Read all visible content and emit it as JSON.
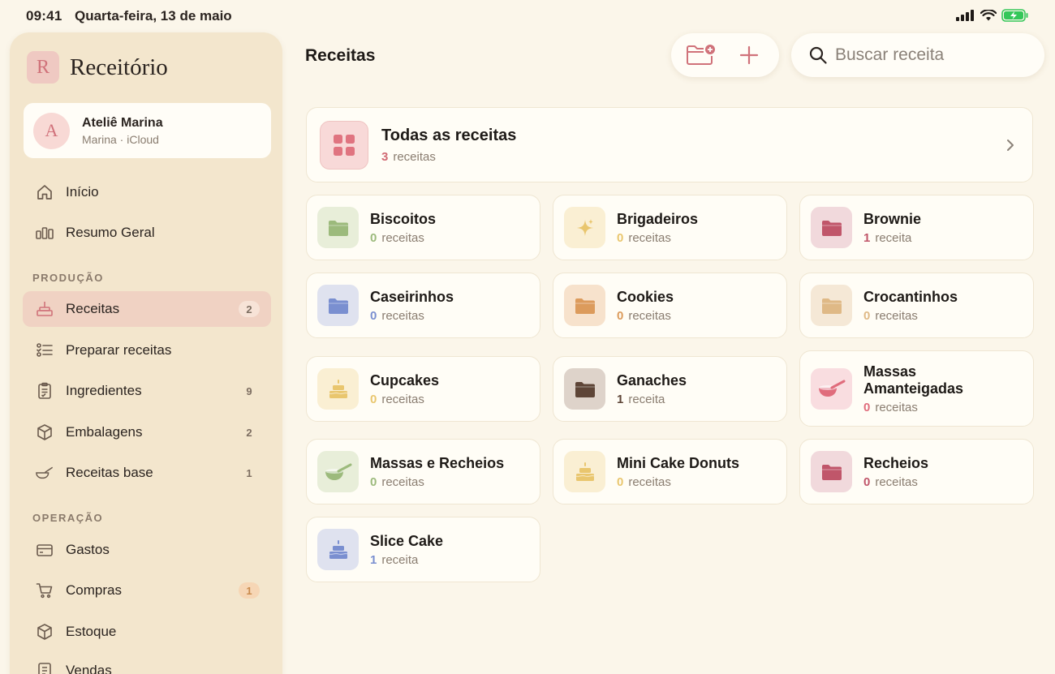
{
  "status": {
    "time": "09:41",
    "date": "Quarta-feira, 13 de maio"
  },
  "sidebar": {
    "brand": {
      "mark": "R",
      "title": "Receitório"
    },
    "account": {
      "initial": "A",
      "name": "Ateliê Marina",
      "subtitle": "Marina · iCloud"
    },
    "items": [
      {
        "label": "Início",
        "icon": "house-icon"
      },
      {
        "label": "Resumo Geral",
        "icon": "bar-chart-icon"
      }
    ],
    "sections": [
      {
        "title": "PRODUÇÃO",
        "items": [
          {
            "label": "Receitas",
            "icon": "cake-icon",
            "badge": "2",
            "active": true
          },
          {
            "label": "Preparar receitas",
            "icon": "checklist-icon",
            "badge": ""
          },
          {
            "label": "Ingredientes",
            "icon": "clipboard-icon",
            "badge": "9"
          },
          {
            "label": "Embalagens",
            "icon": "box-icon",
            "badge": "2"
          },
          {
            "label": "Receitas base",
            "icon": "bowl-icon",
            "badge": "1"
          }
        ]
      },
      {
        "title": "OPERAÇÃO",
        "items": [
          {
            "label": "Gastos",
            "icon": "card-icon",
            "badge": ""
          },
          {
            "label": "Compras",
            "icon": "cart-icon",
            "badge": "1"
          },
          {
            "label": "Estoque",
            "icon": "box-icon",
            "badge": ""
          },
          {
            "label": "Vendas",
            "icon": "receipt-icon",
            "badge": ""
          }
        ]
      }
    ]
  },
  "main": {
    "title": "Receitas",
    "toolbar": {
      "new_folder_icon": "folder-plus-icon",
      "add_icon": "plus-icon"
    },
    "search": {
      "placeholder": "Buscar receita",
      "value": ""
    },
    "all_recipes": {
      "title": "Todas as receitas",
      "count": "3",
      "unit": "receitas"
    },
    "categories": [
      {
        "name": "Biscoitos",
        "count": "0",
        "unit": "receitas",
        "icon": "folder-icon",
        "color": "#9cba7c",
        "bg": "#e8eed9"
      },
      {
        "name": "Brigadeiros",
        "count": "0",
        "unit": "receitas",
        "icon": "sparkle-icon",
        "color": "#e9c66e",
        "bg": "#faefd3"
      },
      {
        "name": "Brownie",
        "count": "1",
        "unit": "receita",
        "icon": "folder-icon",
        "color": "#c0566a",
        "bg": "#f1d9dc"
      },
      {
        "name": "Caseirinhos",
        "count": "0",
        "unit": "receitas",
        "icon": "folder-icon",
        "color": "#7a8fd0",
        "bg": "#dfe2ef"
      },
      {
        "name": "Cookies",
        "count": "0",
        "unit": "receitas",
        "icon": "folder-icon",
        "color": "#dc9b5c",
        "bg": "#f7e2cc"
      },
      {
        "name": "Crocantinhos",
        "count": "0",
        "unit": "receitas",
        "icon": "folder-icon",
        "color": "#dfb986",
        "bg": "#f5e8d6"
      },
      {
        "name": "Cupcakes",
        "count": "0",
        "unit": "receitas",
        "icon": "cake-icon",
        "color": "#e9c66e",
        "bg": "#faefd3"
      },
      {
        "name": "Ganaches",
        "count": "1",
        "unit": "receita",
        "icon": "folder-icon",
        "color": "#5e4537",
        "bg": "#ded3ca"
      },
      {
        "name": "Massas Amanteigadas",
        "count": "0",
        "unit": "receitas",
        "icon": "bowl-icon",
        "color": "#e06c7c",
        "bg": "#f9dde0"
      },
      {
        "name": "Massas e Recheios",
        "count": "0",
        "unit": "receitas",
        "icon": "bowl-icon",
        "color": "#9cba7c",
        "bg": "#e8eed9"
      },
      {
        "name": "Mini Cake Donuts",
        "count": "0",
        "unit": "receitas",
        "icon": "cake-icon",
        "color": "#e9c66e",
        "bg": "#faefd3"
      },
      {
        "name": "Recheios",
        "count": "0",
        "unit": "receitas",
        "icon": "folder-icon",
        "color": "#c0566a",
        "bg": "#f1d9dc"
      },
      {
        "name": "Slice Cake",
        "count": "1",
        "unit": "receita",
        "icon": "cake-icon",
        "color": "#7a8fd0",
        "bg": "#dfe2ef"
      }
    ]
  },
  "colors": {
    "accent": "#d0727a",
    "background": "#fbf6ea",
    "sidebar": "#f3e6cd"
  }
}
